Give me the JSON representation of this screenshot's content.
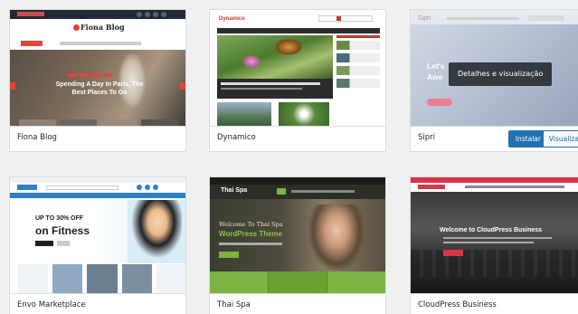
{
  "themes": [
    {
      "name": "Fiona Blog",
      "preview": {
        "logo": "Fiona Blog",
        "hero_title": "Spending A Day In Paris, The Best Places To Go"
      }
    },
    {
      "name": "Dynamico",
      "preview": {
        "logo": "Dynamico"
      }
    },
    {
      "name": "Sipri",
      "preview": {
        "logo": "Sipri",
        "hero_fragment_1": "Let's",
        "hero_fragment_2": "Awe",
        "overlay_label": "Detalhes e visualização"
      },
      "actions": {
        "install_label": "Instalar",
        "preview_label": "Visualizar"
      }
    },
    {
      "name": "Envo Marketplace",
      "preview": {
        "promo_line": "UP TO 30% OFF",
        "promo_title": "on Fitness"
      }
    },
    {
      "name": "Thai Spa",
      "preview": {
        "logo": "Thai Spa",
        "hero_subtitle": "Welcome To Thai Spa",
        "hero_title": "WordPress Theme"
      }
    },
    {
      "name": "CloudPress Business",
      "preview": {
        "hero_title": "Welcome to CloudPress Business"
      }
    }
  ],
  "colors": {
    "install_button": "#2271b1",
    "card_border": "#dcdcde",
    "background": "#f0f0f1"
  }
}
